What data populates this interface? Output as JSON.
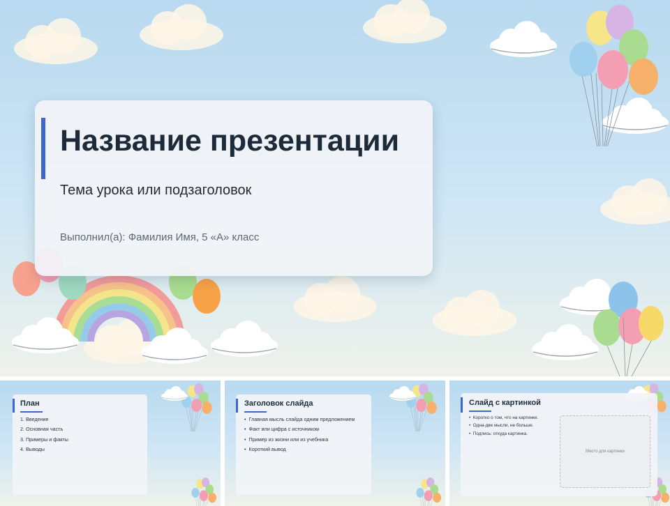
{
  "main_slide": {
    "title": "Название презентации",
    "subtitle": "Тема урока или подзаголовок",
    "author": "Выполнил(а): Фамилия Имя, 5 «А» класс"
  },
  "thumbnails": [
    {
      "title": "План",
      "items": [
        "1. Введение",
        "2. Основная часть",
        "3. Примеры и факты",
        "4. Выводы"
      ]
    },
    {
      "title": "Заголовок слайда",
      "items": [
        "Главная мысль слайда одним предложением",
        "Факт или цифра с источником",
        "Пример из жизни или из учебника",
        "Короткий вывод"
      ]
    },
    {
      "title": "Слайд с картинкой",
      "items": [
        "Коротко о том, что на картинке.",
        "Одна-две мысли, не больше.",
        "Подпись: откуда картинка."
      ],
      "placeholder": "Место для картинки"
    }
  ],
  "colors": {
    "sky": "#bfdcef",
    "accent": "#3e67c7",
    "title_text": "#1c2a3a"
  }
}
